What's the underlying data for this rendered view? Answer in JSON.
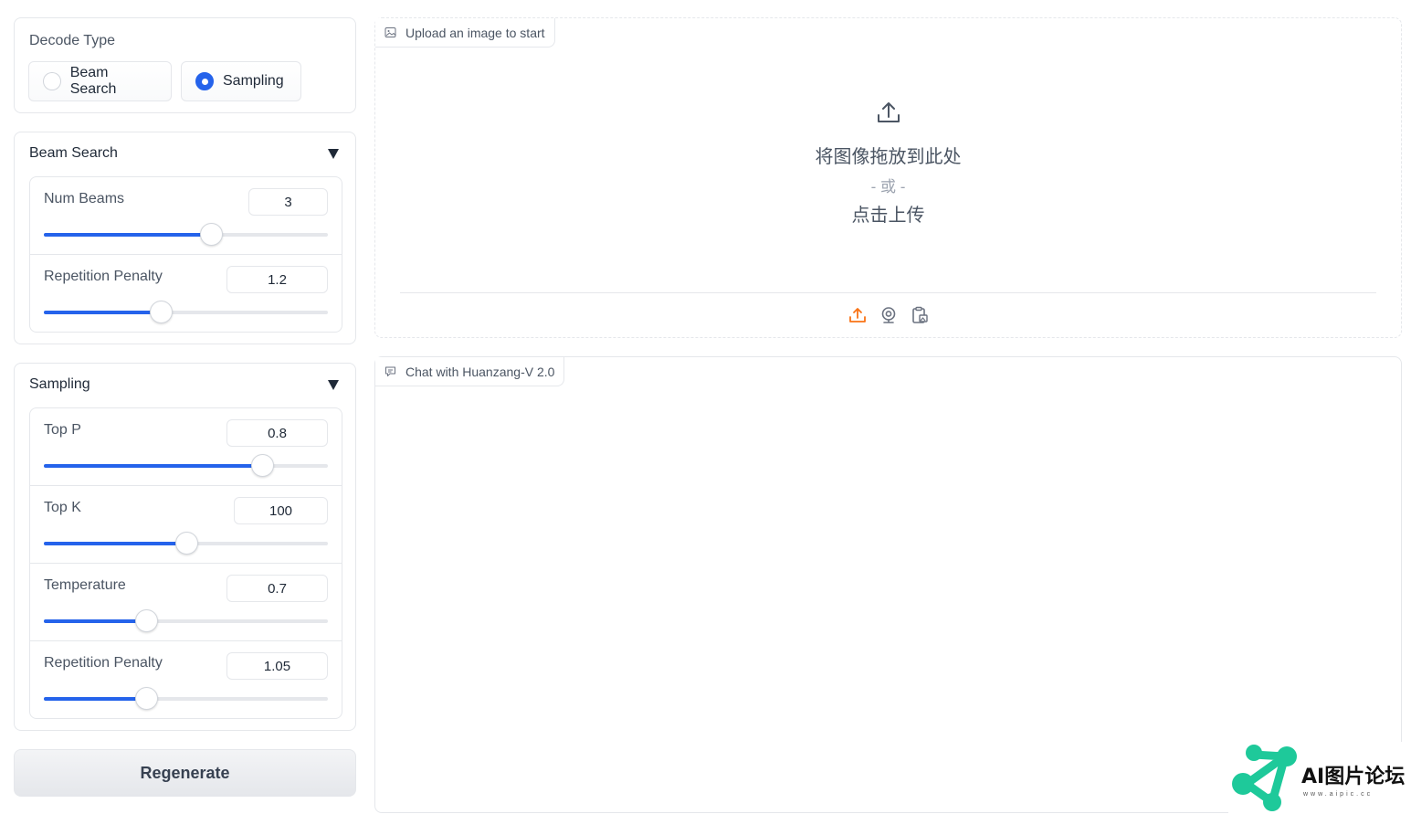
{
  "decode_type": {
    "label": "Decode Type",
    "options": [
      {
        "label": "Beam Search",
        "checked": false
      },
      {
        "label": "Sampling",
        "checked": true
      }
    ]
  },
  "beam_search": {
    "title": "Beam Search",
    "num_beams": {
      "label": "Num Beams",
      "value": "3",
      "fraction": 0.59
    },
    "repetition_penalty": {
      "label": "Repetition Penalty",
      "value": "1.2",
      "fraction": 0.41
    }
  },
  "sampling": {
    "title": "Sampling",
    "top_p": {
      "label": "Top P",
      "value": "0.8",
      "fraction": 0.77
    },
    "top_k": {
      "label": "Top K",
      "value": "100",
      "fraction": 0.5
    },
    "temperature": {
      "label": "Temperature",
      "value": "0.7",
      "fraction": 0.36
    },
    "repetition_penalty": {
      "label": "Repetition Penalty",
      "value": "1.05",
      "fraction": 0.36
    }
  },
  "regenerate_label": "Regenerate",
  "upload": {
    "tag": "Upload an image to start",
    "drop_text": "将图像拖放到此处",
    "or_text": "- 或 -",
    "click_text": "点击上传"
  },
  "chat": {
    "tag": "Chat with Huanzang-V 2.0"
  },
  "watermark": {
    "text": "AI图片论坛",
    "url": "www.aipic.cc"
  },
  "colors": {
    "accent": "#2563eb",
    "upload_orange": "#f97316",
    "logo_green": "#1ec99a"
  }
}
